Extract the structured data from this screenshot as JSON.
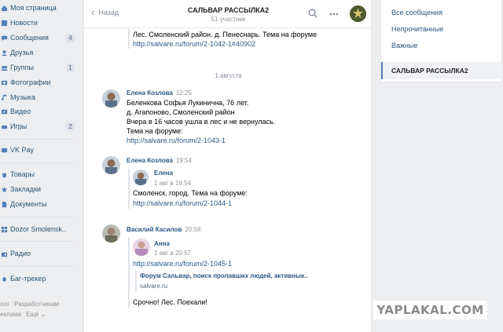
{
  "nav": {
    "items": [
      {
        "label": "Моя страница",
        "icon": "home-icon",
        "count": ""
      },
      {
        "label": "Новости",
        "icon": "news-icon",
        "count": ""
      },
      {
        "label": "Сообщения",
        "icon": "messages-icon",
        "count": "4"
      },
      {
        "label": "Друзья",
        "icon": "friends-icon",
        "count": ""
      },
      {
        "label": "Группы",
        "icon": "groups-icon",
        "count": "1"
      },
      {
        "label": "Фотографии",
        "icon": "photos-icon",
        "count": ""
      },
      {
        "label": "Музыка",
        "icon": "music-icon",
        "count": ""
      },
      {
        "label": "Видео",
        "icon": "video-icon",
        "count": ""
      },
      {
        "label": "Игры",
        "icon": "games-icon",
        "count": "2"
      },
      {
        "label": "VK Pay",
        "icon": "vkpay-icon",
        "count": ""
      },
      {
        "label": "Товары",
        "icon": "goods-icon",
        "count": ""
      },
      {
        "label": "Закладки",
        "icon": "bookmarks-icon",
        "count": ""
      },
      {
        "label": "Документы",
        "icon": "docs-icon",
        "count": ""
      },
      {
        "label": "Dozor Smolensk..",
        "icon": "app-icon",
        "count": ""
      },
      {
        "label": "Радио",
        "icon": "radio-icon",
        "count": ""
      },
      {
        "label": "Баг-трекер",
        "icon": "bugtracker-icon",
        "count": ""
      }
    ],
    "footer": {
      "blog": "лог",
      "devs": "Разработчикам",
      "ads": "еклама",
      "more": "Ещё ⌄"
    }
  },
  "chat": {
    "back_label": "Назад",
    "title": "САЛЬВАР РАССЫЛКА2",
    "subtitle": "51 участник",
    "top_fwd": {
      "line1": "Лес. Смоленский район. д. Пенеснарь. Тема на форуме",
      "line2": "http://salvare.ru/forum/2-1042-1#40902"
    },
    "date_separator": "1 августа",
    "messages": [
      {
        "author": "Елена Козлова",
        "time": "12:25",
        "lines": [
          "Беленкова Софья Лукинична, 76 лет.",
          "д. Агапоново, Смоленский район",
          "Вчера в 16 часов ушла в лес и не вернулась.",
          "Тема на форуме:",
          "http://salvare.ru/forum/2-1043-1"
        ]
      },
      {
        "author": "Елена Козлова",
        "time": "19:54",
        "fwd_author": "Елена",
        "fwd_time": "1 авг в 19:54",
        "lines": [
          "Смоленск, город. Тема на форуме:",
          "http://salvare.ru/forum/2-1044-1"
        ]
      },
      {
        "author": "Василий Касилов",
        "time": "20:58",
        "fwd_author": "Анна",
        "fwd_time": "1 авг в 20:57",
        "url": "http://salvare.ru/forum/2-1045-1",
        "snippet_title": "Форум Сальвар, поиск пропавших людей, активные..",
        "snippet_site": "salvare.ru",
        "text": "Срочно! Лес. Поехали!"
      }
    ]
  },
  "right": {
    "items": [
      "Все сообщения",
      "Непрочитанные",
      "Важные"
    ],
    "active": "САЛЬВАР РАССЫЛКА2"
  },
  "watermark": "YAPLAKAL.COM",
  "colors": {
    "accent": "#2a5885",
    "bg": "#edeef0",
    "nav_text": "#285473"
  }
}
